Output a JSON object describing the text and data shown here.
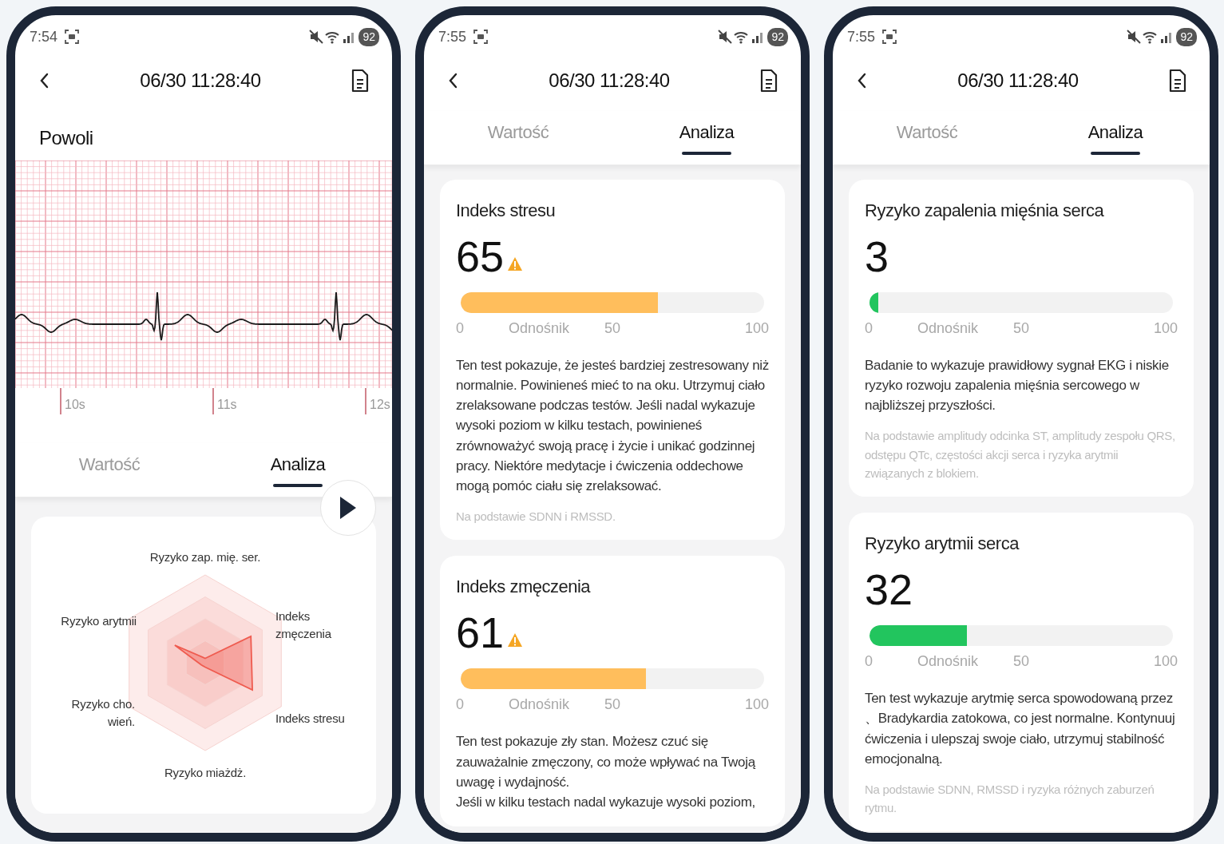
{
  "phones": [
    {
      "kind": "ecg",
      "status": {
        "time": "7:54",
        "battery": "92"
      },
      "header": {
        "title": "06/30 11:28:40"
      },
      "speed": "Powoli",
      "ecg_labels": [
        "10s",
        "11s",
        "12s"
      ],
      "tabs": [
        {
          "label": "Wartość",
          "selected": false
        },
        {
          "label": "Analiza",
          "selected": true
        }
      ],
      "radar": {
        "labels": [
          "Ryzyko zap. mię. ser.",
          "Ryzyko arytmii",
          "Indeks zmęczenia",
          "Ryzyko cho. wień.",
          "Indeks stresu",
          "Ryzyko miażdż."
        ]
      }
    },
    {
      "kind": "cards",
      "status": {
        "time": "7:55",
        "battery": "92"
      },
      "header": {
        "title": "06/30 11:28:40"
      },
      "tabs": [
        {
          "label": "Wartość",
          "selected": false
        },
        {
          "label": "Analiza",
          "selected": true
        }
      ],
      "cards": [
        {
          "title": "Indeks stresu",
          "value": "65",
          "warning": true,
          "level": 0.65,
          "color": "#ffbe5c",
          "scale": [
            "0",
            "Odnośnik",
            "50",
            "100"
          ],
          "description": "Ten test pokazuje, że jesteś bardziej zestresowany niż normalnie. Powinieneś mieć to na oku. Utrzymuj ciało zrelaksowane podczas testów. Jeśli nadal wykazuje wysoki poziom w kilku testach, powinieneś zrównoważyć swoją pracę i życie i unikać godzinnej pracy. Niektóre medytacje i ćwiczenia oddechowe mogą pomóc ciału się zrelaksować.",
          "basis": "Na podstawie SDNN i RMSSD."
        },
        {
          "title": "Indeks zmęczenia",
          "value": "61",
          "warning": true,
          "level": 0.61,
          "color": "#ffbe5c",
          "scale": [
            "0",
            "Odnośnik",
            "50",
            "100"
          ],
          "description": "Ten test pokazuje zły stan. Możesz czuć się zauważalnie zmęczony, co może wpływać na Twoją uwagę i wydajność.\nJeśli w kilku testach nadal wykazuje wysoki poziom,"
        }
      ]
    },
    {
      "kind": "cards",
      "status": {
        "time": "7:55",
        "battery": "92"
      },
      "header": {
        "title": "06/30 11:28:40"
      },
      "tabs": [
        {
          "label": "Wartość",
          "selected": false
        },
        {
          "label": "Analiza",
          "selected": true
        }
      ],
      "cards": [
        {
          "title": "Ryzyko zapalenia mięśnia serca",
          "value": "3",
          "warning": false,
          "level": 0.03,
          "color": "#22c55e",
          "scale": [
            "0",
            "Odnośnik",
            "50",
            "100"
          ],
          "description": "Badanie to wykazuje prawidłowy sygnał EKG i niskie ryzyko rozwoju zapalenia mięśnia sercowego w najbliższej przyszłości.",
          "basis": "Na podstawie amplitudy odcinka ST, amplitudy zespołu QRS, odstępu QTc, częstości akcji serca i ryzyka arytmii związanych z blokiem."
        },
        {
          "title": "Ryzyko arytmii serca",
          "value": "32",
          "warning": false,
          "level": 0.32,
          "color": "#22c55e",
          "scale": [
            "0",
            "Odnośnik",
            "50",
            "100"
          ],
          "description": "Ten test wykazuje arytmię serca spowodowaną przez 、Bradykardia zatokowa, co jest normalne. Kontynuuj ćwiczenia i ulepszaj swoje ciało, utrzymuj stabilność emocjonalną.",
          "basis": "Na podstawie SDNN, RMSSD i ryzyka różnych zaburzeń rytmu."
        }
      ]
    }
  ]
}
